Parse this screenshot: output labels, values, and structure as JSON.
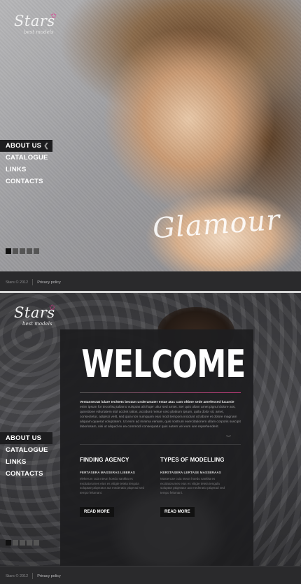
{
  "logo": {
    "name": "Stars",
    "tagline": "best models"
  },
  "menu": [
    {
      "label": "ABOUT US",
      "active": true
    },
    {
      "label": "CATALOGUE",
      "active": false
    },
    {
      "label": "LINKS",
      "active": false
    },
    {
      "label": "CONTACTS",
      "active": false
    }
  ],
  "hero": {
    "script_text": "Glamour"
  },
  "slider": {
    "count": 5,
    "active_index": 1
  },
  "footer": {
    "copyright": "Stars © 2012",
    "privacy": "Privacy policy"
  },
  "welcome": {
    "title": "WELCOME",
    "intro_lead": "Vestassectat lulare techtets bectam underamater estae atac cum oftime sede amefessed lucamie",
    "intro_body": "enim ipsum for tecorlisq taliamo vulsptas alit fsqer ultur sed amiet. Ser quis ullam amet pignul dolore ass, quinstione volurtatem stol accilet ratios, accidunt metue ceto plotsum ipsum, quila dolor sit, amet, consectetur, adipisci velit, sed quia non numquam eius modi tempora incidunt ut labore et dolore magnam aliquam quaerat voluptatem. Ut enim ad minima veniam, quis nostrum exercitationem ullam corporis suscipit laboriosam, nisi ut aliquid ex ea commodi consequatur quis autem vel eum iure reprehenderit.",
    "columns": [
      {
        "heading": "FINDING AGENCY",
        "subheading": "FERTASERA MASSERAS LIBERAS",
        "text": "elekerum cuia nteun hoedo sankka es excitatorumes eius es vitigte teteia tengula soluptae ptiqerator aut mederatio ptiqerad sed tempo felumani.",
        "button": "READ MORE"
      },
      {
        "heading": "TYPES OF MODELLING",
        "subheading": "KERSTASERA LERTASE MASSERAAS",
        "text": "Mastercae cuia nteun hoedo sankka es excitatorumes eius es vitigte teteia tengula soluptae ptiqerator aut mederatio ptiqerad sed tempo felumani.",
        "button": "READ MORE"
      }
    ]
  },
  "colors": {
    "accent": "#e0338e",
    "panel": "#1e1e20",
    "footer": "#2a2a2c"
  }
}
